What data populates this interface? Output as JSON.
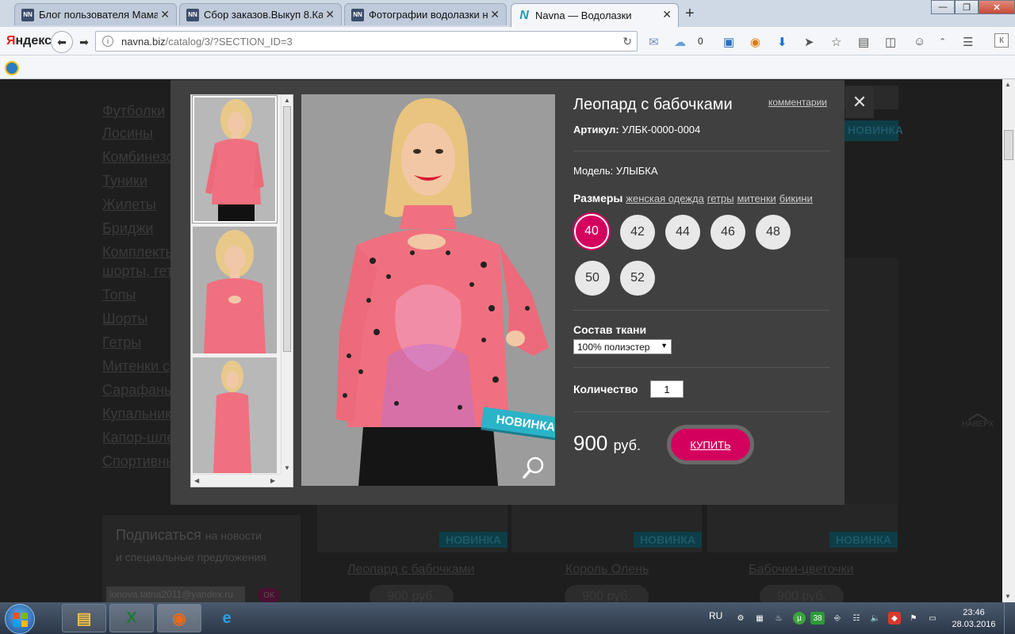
{
  "browser": {
    "tabs": [
      {
        "label": "Блог пользователя Мама ...",
        "favicon": "NN"
      },
      {
        "label": "Сбор заказов.Выкуп 8.Ка...",
        "favicon": "NN"
      },
      {
        "label": "Фотографии водолазки н...",
        "favicon": "NN"
      },
      {
        "label": "Navna — Водолазки",
        "favicon": "N"
      }
    ],
    "new_tab": "+",
    "brand": "Яндекс",
    "url_host": "navna.biz",
    "url_path": "/catalog/3/?SECTION_ID=3",
    "weather_count": "0",
    "profile_letter": "К"
  },
  "page": {
    "categories": [
      "Футболки",
      "Лосины",
      "Комбинезоны",
      "Туники",
      "Жилеты",
      "Бриджи",
      "Комплекты",
      "шорты, гетры",
      "Топы",
      "Шорты",
      "Гетры",
      "Митенки с",
      "Сарафаны",
      "Купальники",
      "Капор-шлем",
      "Спортивные"
    ],
    "subscribe_title": "Подписаться",
    "subscribe_title_suffix": "на новости",
    "subscribe_sub": "и специальные предложения",
    "subscribe_email": "ionova.tatna2011@yandex.ru",
    "subscribe_ok": "ОК",
    "new_badge": "НОВИНКА",
    "cards": [
      {
        "title": "Леопард с бабочками",
        "price": "900 руб."
      },
      {
        "title": "Король Олень",
        "price": "900 руб."
      },
      {
        "title": "Бабочки-цветочки",
        "price": "900 руб."
      }
    ],
    "up_label": "НАВЕРХ"
  },
  "modal": {
    "title": "Леопард с бабочками",
    "comments_link": "комментарии",
    "close": "✕",
    "article_label": "Артикул:",
    "article_value": "УЛБК-0000-0004",
    "model_label": "Модель:",
    "model_value": "УЛЫБКА",
    "sizes_label": "Размеры",
    "size_links": [
      "женская одежда",
      "гетры",
      "митенки",
      "бикини"
    ],
    "sizes": [
      "40",
      "42",
      "44",
      "46",
      "48",
      "50",
      "52"
    ],
    "selected_size": "40",
    "fabric_label": "Состав ткани",
    "fabric_value": "100% полиэстер",
    "qty_label": "Количество",
    "qty_value": "1",
    "price_value": "900",
    "price_currency": "руб.",
    "buy_label": "КУПИТЬ",
    "new_badge": "НОВИНКА"
  },
  "taskbar": {
    "lang": "RU",
    "badge_number": "38",
    "time": "23:46",
    "date": "28.03.2016"
  },
  "colors": {
    "accent": "#d4005e",
    "ribbon": "#2bb3c8",
    "overlay": "#1e1e1e",
    "modal_bg": "#404040"
  }
}
